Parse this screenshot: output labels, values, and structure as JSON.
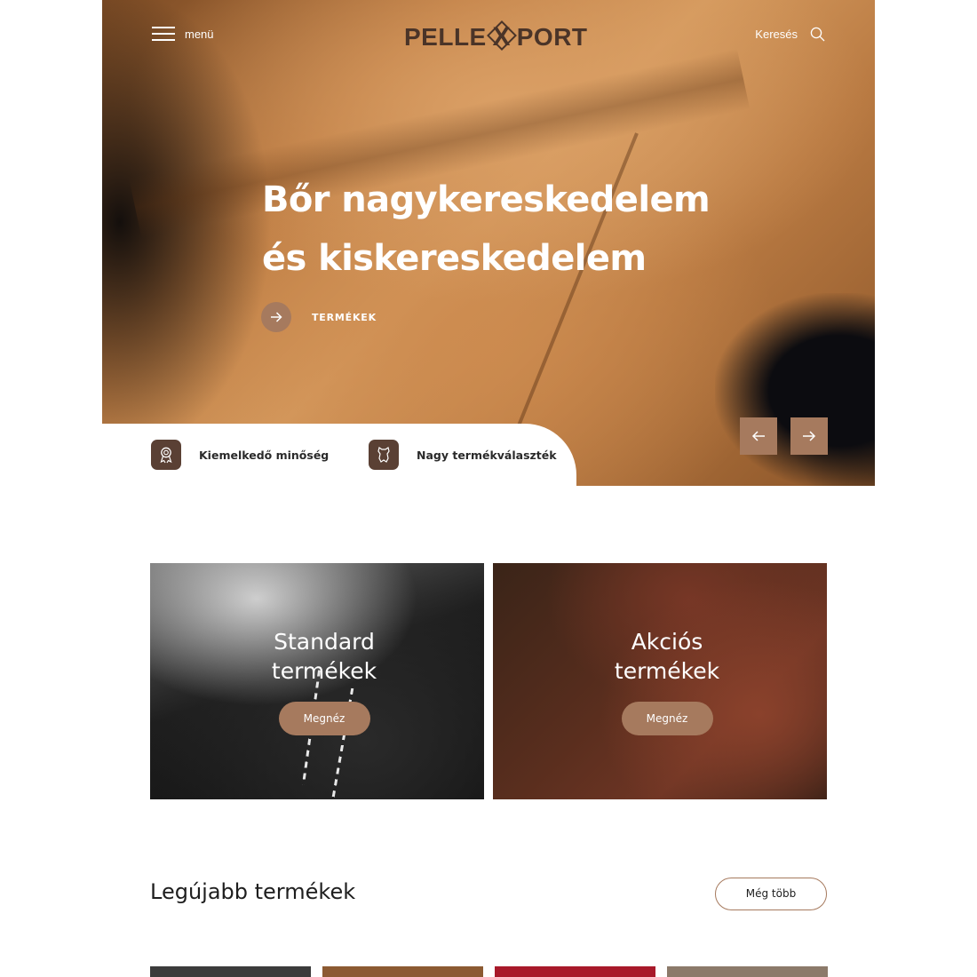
{
  "header": {
    "menu_label": "menü",
    "logo_text_left": "PELLE",
    "logo_text_x": "X",
    "logo_text_right": "PORT",
    "search_label": "Keresés"
  },
  "hero": {
    "title_line1": "Bőr nagykereskedelem",
    "title_line2": "és kiskereskedelem",
    "cta_label": "TERMÉKEK"
  },
  "features": [
    {
      "label": "Kiemelkedő minőség",
      "icon": "award-ribbon-icon"
    },
    {
      "label": "Nagy termékválaszték",
      "icon": "leather-hide-icon"
    }
  ],
  "categories": [
    {
      "title_line1": "Standard",
      "title_line2": "termékek",
      "button": "Megnéz"
    },
    {
      "title_line1": "Akciós",
      "title_line2": "termékek",
      "button": "Megnéz"
    }
  ],
  "latest": {
    "title": "Legújabb termékek",
    "more_label": "Még több"
  },
  "colors": {
    "accent": "#a67a5e",
    "icon_bg": "#5a4034",
    "logo": "#4a3428"
  }
}
